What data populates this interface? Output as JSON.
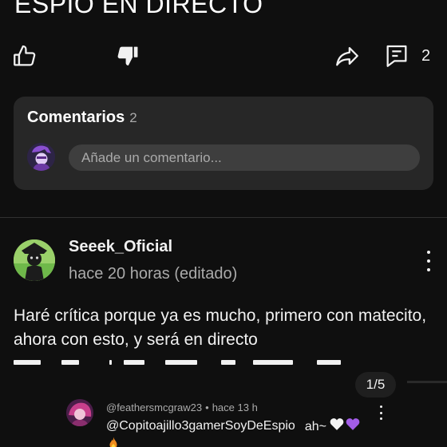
{
  "video": {
    "title": "ESPIO EN DIRECTO"
  },
  "actions": {
    "like_icon": "thumb-up-icon",
    "dislike_icon": "thumb-down-filled-icon",
    "share_icon": "share-arrow-icon",
    "comments_icon": "comments-icon",
    "comments_count": "2"
  },
  "comments_card": {
    "title": "Comentarios",
    "count": "2",
    "input_placeholder": "Añade un comentario..."
  },
  "comment": {
    "author": "Seeek_Oficial",
    "time": "hace 20 horas (editado)",
    "text": "Haré crítica porque ya es mucho, primero con matecito, ahora con esto, y será en directo",
    "more_icon": "more-vertical-icon"
  },
  "pager": {
    "label": "1/5"
  },
  "reply": {
    "author": "@feathersmcgraw23",
    "separator": "•",
    "time": "hace 13 h",
    "mention": "@Copitoajillo3gamerSoyDeEspio",
    "text": "ah~",
    "emoji_icons": [
      "white-heart-icon",
      "purple-heart-icon",
      "fire-icon"
    ]
  },
  "colors": {
    "background": "#0f0f0f",
    "card": "#272727",
    "input": "#3e3e3e",
    "secondary_text": "#aaaaaa",
    "purple_heart": "#a35de8"
  }
}
